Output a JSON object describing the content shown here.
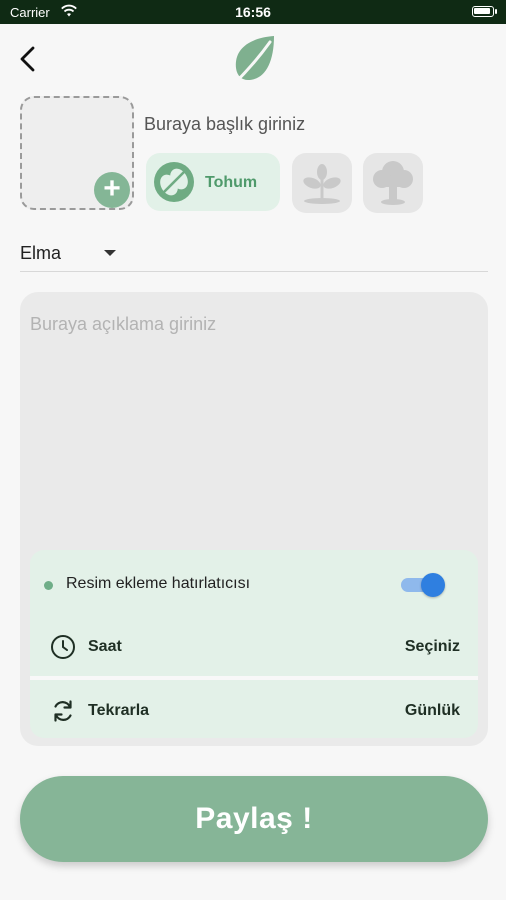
{
  "status_bar": {
    "carrier": "Carrier",
    "time": "16:56"
  },
  "header": {
    "back_icon": "chevron-left-icon",
    "logo_icon": "leaf-icon"
  },
  "form": {
    "title_placeholder": "Buraya başlık giriniz",
    "add_photo_icon": "plus-icon",
    "growth_stages": [
      {
        "label": "Tohum",
        "icon": "seed-icon",
        "selected": true
      },
      {
        "label": "",
        "icon": "sprout-icon",
        "selected": false
      },
      {
        "label": "",
        "icon": "tree-icon",
        "selected": false
      }
    ],
    "plant_select": {
      "value": "Elma",
      "icon": "caret-down-icon"
    },
    "description_placeholder": "Buraya açıklama giriniz"
  },
  "reminder": {
    "label": "Resim ekleme hatırlatıcısı",
    "enabled": true,
    "time": {
      "label": "Saat",
      "value": "Seçiniz",
      "icon": "clock-icon"
    },
    "repeat": {
      "label": "Tekrarla",
      "value": "Günlük",
      "icon": "repeat-icon"
    }
  },
  "actions": {
    "share_label": "Paylaş !"
  },
  "colors": {
    "accent_green": "#84b696",
    "chip_selected_bg": "#e2f1e8",
    "toggle_blue": "#2f7fe0",
    "status_bar_bg": "#0f2a14"
  }
}
